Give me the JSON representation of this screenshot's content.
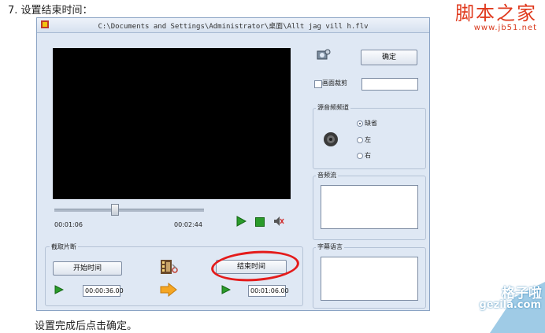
{
  "page": {
    "step_text": "7.  设置结束时间：",
    "footer_text": "设置完成后点击确定。",
    "watermark_top": {
      "main": "脚本之家",
      "url": "www.jb51.net"
    },
    "watermark_bottom": {
      "main": "格子啦",
      "url": "gezila.com"
    }
  },
  "window": {
    "title": "C:\\Documents and Settings\\Administrator\\桌面\\Allt jag vill h.flv",
    "player": {
      "current_time": "00:01:06",
      "total_time": "00:02:44",
      "slider_fraction": 0.4
    },
    "clip": {
      "group_label": "截取片断",
      "start_button": "开始时间",
      "end_button": "结束时间",
      "start_time": "00:00:36.00",
      "end_time": "00:01:06.00"
    },
    "ok_button": "确定",
    "crop_label": "画面裁剪",
    "audio": {
      "group_label": "源音频频道",
      "options": [
        "缺省",
        "左",
        "右"
      ],
      "selected": "缺省"
    },
    "stream_label": "音频流",
    "subtitle_label": "字幕语言"
  },
  "colors": {
    "annotation_circle": "#e41b1b",
    "window_bg": "#dfe8f4",
    "play_green": "#2a9b2a"
  }
}
